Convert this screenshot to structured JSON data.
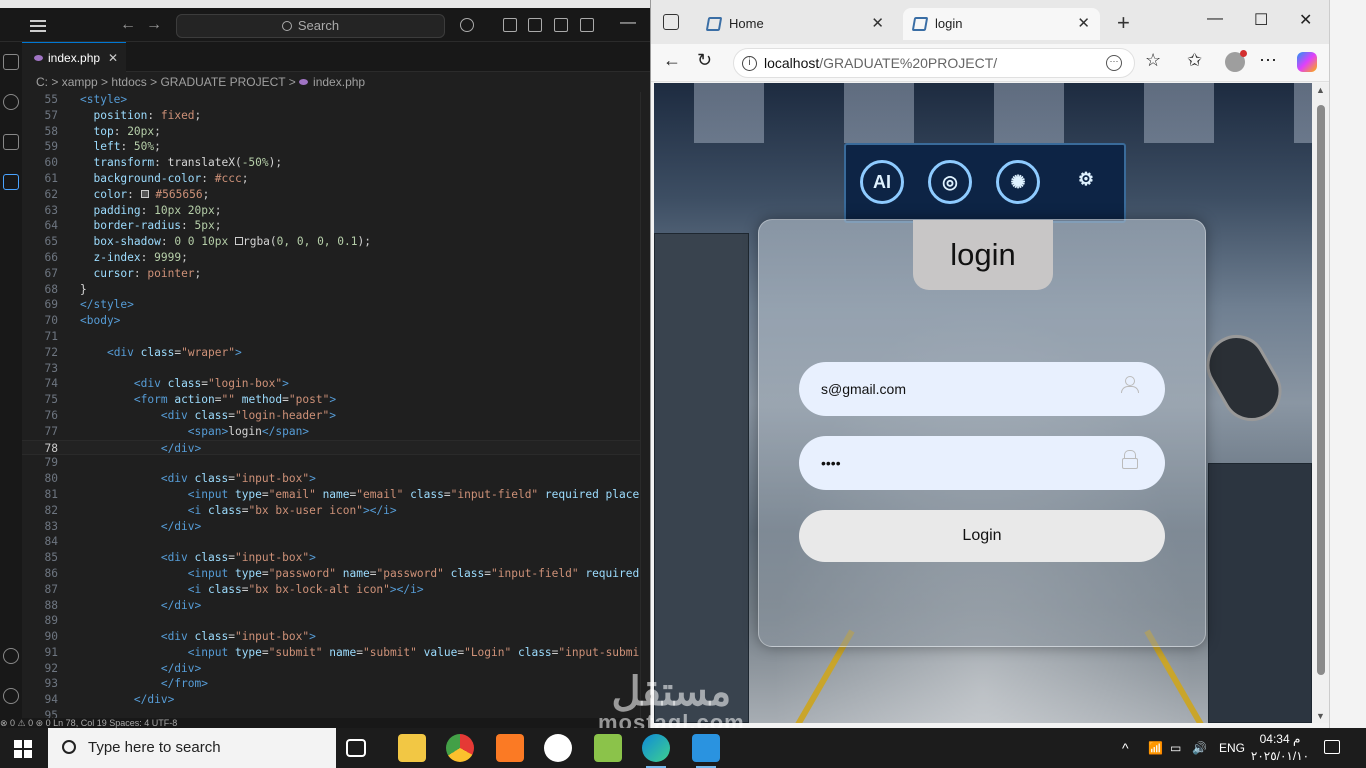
{
  "vscode": {
    "title_fragment": "GRADUATE PROJECT",
    "search_label": "Search",
    "tab_label": "index.php",
    "breadcrumb": [
      "C:",
      "xampp",
      "htdocs",
      "GRADUATE PROJECT",
      "index.php"
    ],
    "lines": [
      {
        "n": "55",
        "html": "<span class='k-tag'>&lt;style&gt;</span>"
      },
      {
        "n": "57",
        "html": "  <span class='k-prop'>position</span>: <span class='k-str'>fixed</span>;"
      },
      {
        "n": "58",
        "html": "  <span class='k-prop'>top</span>: <span class='k-num'>20px</span>;"
      },
      {
        "n": "59",
        "html": "  <span class='k-prop'>left</span>: <span class='k-num'>50%</span>;"
      },
      {
        "n": "60",
        "html": "  <span class='k-prop'>transform</span>: <span class='k-txt'>translateX(</span><span class='k-num'>-50%</span><span class='k-txt'>)</span>;"
      },
      {
        "n": "61",
        "html": "  <span class='k-prop'>background-color</span>: <span class='k-str'>#ccc</span>;"
      },
      {
        "n": "62",
        "html": "  <span class='k-prop'>color</span>: <span style='display:inline-block;width:8px;height:8px;border:1px solid #ccc;background:#565656'></span> <span class='k-str'>#565656</span>;"
      },
      {
        "n": "63",
        "html": "  <span class='k-prop'>padding</span>: <span class='k-num'>10px 20px</span>;"
      },
      {
        "n": "64",
        "html": "  <span class='k-prop'>border-radius</span>: <span class='k-num'>5px</span>;"
      },
      {
        "n": "65",
        "html": "  <span class='k-prop'>box-shadow</span>: <span class='k-num'>0 0 10px</span> <span style='display:inline-block;width:8px;height:8px;border:1px solid #ccc'></span><span class='k-txt'>rgba(</span><span class='k-num'>0, 0, 0, 0.1</span><span class='k-txt'>)</span>;"
      },
      {
        "n": "66",
        "html": "  <span class='k-prop'>z-index</span>: <span class='k-num'>9999</span>;"
      },
      {
        "n": "67",
        "html": "  <span class='k-prop'>cursor</span>: <span class='k-str'>pointer</span>;"
      },
      {
        "n": "68",
        "html": "<span class='k-txt'>}</span>"
      },
      {
        "n": "69",
        "html": "<span class='k-tag'>&lt;/style&gt;</span>"
      },
      {
        "n": "70",
        "html": "<span class='k-tag'>&lt;body&gt;</span>"
      },
      {
        "n": "71",
        "html": ""
      },
      {
        "n": "72",
        "html": "    <span class='k-tag'>&lt;div</span> <span class='k-attr'>class</span>=<span class='k-str'>\"wraper\"</span><span class='k-tag'>&gt;</span>"
      },
      {
        "n": "73",
        "html": ""
      },
      {
        "n": "74",
        "html": "        <span class='k-tag'>&lt;div</span> <span class='k-attr'>class</span>=<span class='k-str'>\"login-box\"</span><span class='k-tag'>&gt;</span>"
      },
      {
        "n": "75",
        "html": "        <span class='k-tag'>&lt;form</span> <span class='k-attr'>action</span>=<span class='k-str'>\"\"</span> <span class='k-attr'>method</span>=<span class='k-str'>\"post\"</span><span class='k-tag'>&gt;</span>"
      },
      {
        "n": "76",
        "html": "            <span class='k-tag'>&lt;div</span> <span class='k-attr'>class</span>=<span class='k-str'>\"login-header\"</span><span class='k-tag'>&gt;</span>"
      },
      {
        "n": "77",
        "html": "                <span class='k-tag'>&lt;span&gt;</span><span class='k-txt'>login</span><span class='k-tag'>&lt;/span&gt;</span>"
      },
      {
        "n": "78",
        "html": "            <span class='k-tag'>&lt;/div&gt;</span>",
        "active": true
      },
      {
        "n": "79",
        "html": ""
      },
      {
        "n": "80",
        "html": "            <span class='k-tag'>&lt;div</span> <span class='k-attr'>class</span>=<span class='k-str'>\"input-box\"</span><span class='k-tag'>&gt;</span>"
      },
      {
        "n": "81",
        "html": "                <span class='k-tag'>&lt;input</span> <span class='k-attr'>type</span>=<span class='k-str'>\"email\"</span> <span class='k-attr'>name</span>=<span class='k-str'>\"email\"</span> <span class='k-attr'>class</span>=<span class='k-str'>\"input-field\"</span> <span class='k-attr'>required placeholo</span>"
      },
      {
        "n": "82",
        "html": "                <span class='k-tag'>&lt;i</span> <span class='k-attr'>class</span>=<span class='k-str'>\"bx bx-user icon\"</span><span class='k-tag'>&gt;&lt;/i&gt;</span>"
      },
      {
        "n": "83",
        "html": "            <span class='k-tag'>&lt;/div&gt;</span>"
      },
      {
        "n": "84",
        "html": ""
      },
      {
        "n": "85",
        "html": "            <span class='k-tag'>&lt;div</span> <span class='k-attr'>class</span>=<span class='k-str'>\"input-box\"</span><span class='k-tag'>&gt;</span>"
      },
      {
        "n": "86",
        "html": "                <span class='k-tag'>&lt;input</span> <span class='k-attr'>type</span>=<span class='k-str'>\"password\"</span> <span class='k-attr'>name</span>=<span class='k-str'>\"password\"</span> <span class='k-attr'>class</span>=<span class='k-str'>\"input-field\"</span> <span class='k-attr'>required rec</span>"
      },
      {
        "n": "87",
        "html": "                <span class='k-tag'>&lt;i</span> <span class='k-attr'>class</span>=<span class='k-str'>\"bx bx-lock-alt icon\"</span><span class='k-tag'>&gt;&lt;/i&gt;</span>"
      },
      {
        "n": "88",
        "html": "            <span class='k-tag'>&lt;/div&gt;</span>"
      },
      {
        "n": "89",
        "html": ""
      },
      {
        "n": "90",
        "html": "            <span class='k-tag'>&lt;div</span> <span class='k-attr'>class</span>=<span class='k-str'>\"input-box\"</span><span class='k-tag'>&gt;</span>"
      },
      {
        "n": "91",
        "html": "                <span class='k-tag'>&lt;input</span> <span class='k-attr'>type</span>=<span class='k-str'>\"submit\"</span> <span class='k-attr'>name</span>=<span class='k-str'>\"submit\"</span> <span class='k-attr'>value</span>=<span class='k-str'>\"Login\"</span> <span class='k-attr'>class</span>=<span class='k-str'>\"input-submit\"</span><span class='k-tag'>&gt;</span>"
      },
      {
        "n": "92",
        "html": "            <span class='k-tag'>&lt;/div&gt;</span>"
      },
      {
        "n": "93",
        "html": "            <span class='k-tag'>&lt;/from&gt;</span>"
      },
      {
        "n": "94",
        "html": "        <span class='k-tag'>&lt;/div&gt;</span>"
      },
      {
        "n": "95",
        "html": ""
      }
    ],
    "status": "⊗ 0 ⚠ 0   ⊛ 0        Ln 78, Col 19   Spaces: 4   UTF-8"
  },
  "edge": {
    "tabs": [
      {
        "label": "Home",
        "active": false
      },
      {
        "label": "login",
        "active": true
      }
    ],
    "url_host": "localhost",
    "url_path": "/GRADUATE%20PROJECT/"
  },
  "page": {
    "header": "login",
    "email_value": "s@gmail.com",
    "password_value": "••••",
    "submit_label": "Login",
    "screen_icons": [
      "AI",
      "◎",
      "✺",
      "⚙"
    ]
  },
  "watermark": {
    "arabic": "مستقل",
    "latin": "mostaql.com"
  },
  "taskbar": {
    "search_placeholder": "Type here to search",
    "language": "ENG",
    "time": "04:34 م",
    "date": "٢٠٢٥/٠١/١٠"
  }
}
